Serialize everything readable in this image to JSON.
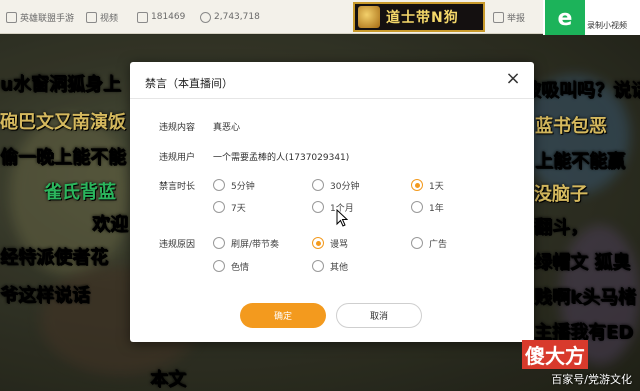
{
  "topbar": {
    "items": [
      {
        "label": "英雄联盟手游",
        "icon": "tag-icon"
      },
      {
        "label": "视频",
        "icon": "video-icon"
      },
      {
        "label": "181469",
        "icon": "id-icon"
      },
      {
        "label": "2,743,718",
        "icon": "heat-icon"
      },
      {
        "label": "举报",
        "icon": "report-icon"
      }
    ],
    "banner": "道士带N狗",
    "record_label": "录制小视频",
    "record_icon": "e-icon"
  },
  "danmaku": [
    {
      "text": "u水窗洞狐身上",
      "color": "#e9e9e9"
    },
    {
      "text": "砲巴文又南演饭",
      "color": "#f3d36b"
    },
    {
      "text": "偷一晚上能不能",
      "color": "#ffffff"
    },
    {
      "text": "雀氏背蓝",
      "color": "#32d06a"
    },
    {
      "text": "欢迎",
      "color": "#ffffff"
    },
    {
      "text": "经特派使者花",
      "color": "#ffffff"
    },
    {
      "text": "爷这样说话",
      "color": "#ffffff"
    },
    {
      "text": "被吸叫吗？说话",
      "color": "#ffffff"
    },
    {
      "text": "蓝书包恶",
      "color": "#f3d36b"
    },
    {
      "text": "上能不能赢",
      "color": "#ffffff"
    },
    {
      "text": "没脑子",
      "color": "#f3d36b"
    },
    {
      "text": "翻斗，",
      "color": "#ffffff"
    },
    {
      "text": "绿帽文 狐臭",
      "color": "#ffffff"
    },
    {
      "text": "贱啊k头马楮",
      "color": "#ffffff"
    },
    {
      "text": "主播我有ED",
      "color": "#ffffff"
    },
    {
      "text": "本文",
      "color": "#ffffff"
    }
  ],
  "modal": {
    "title": "禁言（本直播间）",
    "close_icon": "close-icon",
    "fields": {
      "content_label": "违规内容",
      "content_value": "真恶心",
      "user_label": "违规用户",
      "user_value": "一个需要孟棒的人(1737029341)",
      "duration_label": "禁言时长",
      "reason_label": "违规原因"
    },
    "durations": [
      {
        "label": "5分钟",
        "selected": false
      },
      {
        "label": "30分钟",
        "selected": false
      },
      {
        "label": "1天",
        "selected": true
      },
      {
        "label": "7天",
        "selected": false
      },
      {
        "label": "1个月",
        "selected": false
      },
      {
        "label": "1年",
        "selected": false
      }
    ],
    "reasons": [
      {
        "label": "刷屏/带节奏",
        "selected": false
      },
      {
        "label": "谩骂",
        "selected": true
      },
      {
        "label": "广告",
        "selected": false
      },
      {
        "label": "色情",
        "selected": false
      },
      {
        "label": "其他",
        "selected": false
      }
    ],
    "confirm_label": "确定",
    "cancel_label": "取消"
  },
  "watermark": "百家号/党游文化",
  "logo_watermark": "傻大方",
  "colors": {
    "accent": "#f39a1e",
    "brand_green": "#1cb35a"
  }
}
